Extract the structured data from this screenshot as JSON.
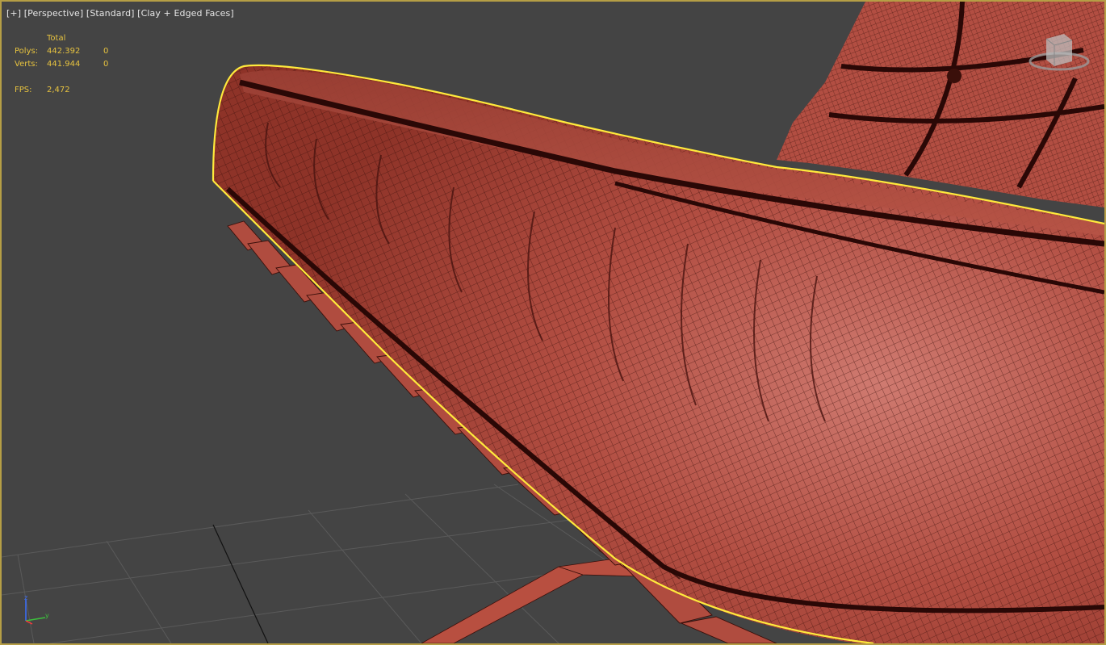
{
  "viewport": {
    "labels": {
      "plus": "[+]",
      "view": "[Perspective]",
      "shading_mode": "[Standard]",
      "display_style": "[Clay + Edged Faces]"
    },
    "stats": {
      "header_total": "Total",
      "polys_label": "Polys:",
      "polys_total": "442.392",
      "polys_selected": "0",
      "verts_label": "Verts:",
      "verts_total": "441.944",
      "verts_selected": "0",
      "fps_label": "FPS:",
      "fps_value": "2,472"
    },
    "axis_tripod": {
      "z": "z",
      "y": "y"
    },
    "colors": {
      "background": "#444444",
      "border": "#b59e45",
      "stats_text": "#e7c33f",
      "label_text": "#e6e6e6",
      "mesh": "#b04d40",
      "wire": "#2a0a06",
      "selection": "#ffea3c"
    }
  }
}
